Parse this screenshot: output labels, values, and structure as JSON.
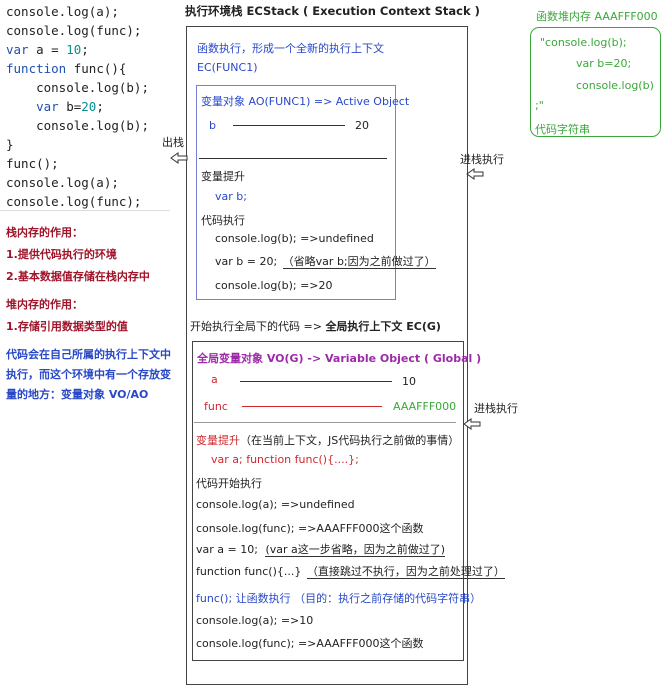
{
  "code": {
    "lines": [
      "console.log(a);",
      "console.log(func);",
      "var a = 10;",
      "function func(){",
      "    console.log(b);",
      "    var b=20;",
      "    console.log(b);",
      "}",
      "func();",
      "console.log(a);",
      "console.log(func);"
    ]
  },
  "notes": {
    "stack_title": "栈内存的作用：",
    "stack_1": "1.提供代码执行的环境",
    "stack_2": "2.基本数据值存储在栈内存中",
    "heap_title": "堆内存的作用：",
    "heap_1": "1.存储引用数据类型的值",
    "context_1": "代码会在自己所属的执行上下文中",
    "context_2": "执行，而这个环境中有一个存放变",
    "context_3": "量的地方：变量对象 VO/AO"
  },
  "ecstack": {
    "title": "执行环境栈  ECStack ( Execution Context Stack )",
    "exit_label": "出栈",
    "enter_label_1": "进栈执行",
    "enter_label_2": "进栈执行"
  },
  "func_ctx": {
    "line1": "函数执行，形成一个全新的执行上下文",
    "line2": "EC(FUNC1)",
    "ao_title": "变量对象 AO(FUNC1) => Active Object",
    "var_b": "b",
    "val_b": "20",
    "hoist_title": "变量提升",
    "hoist_code": "var b;",
    "exec_title": "代码执行",
    "exec_1": "console.log(b);  =>undefined",
    "exec_2a": "var b = 20;",
    "exec_2b": "（省略var b;因为之前做过了）",
    "exec_3": "console.log(b);  =>20"
  },
  "global_ctx": {
    "header_a": "开始执行全局下的代码  =>",
    "header_b": "全局执行上下文  EC(G)",
    "vo_title": "全局变量对象 VO(G)  -> Variable Object  ( Global )",
    "var_a": "a",
    "val_a": "10",
    "var_func": "func",
    "val_func": "AAAFFF000",
    "hoist_title": "变量提升",
    "hoist_desc": "（在当前上下文，JS代码执行之前做的事情）",
    "hoist_code": "var a;    function func(){....};",
    "exec_title": "代码开始执行",
    "exec_1": "console.log(a);  =>undefined",
    "exec_2": "console.log(func); =>AAAFFF000这个函数",
    "exec_3a": "var a = 10;",
    "exec_3b": "(var a这一步省略，因为之前做过了)",
    "exec_4a": "function func(){...}",
    "exec_4b": "（直接跳过不执行，因为之前处理过了）",
    "exec_5": "func();  让函数执行  （目的：执行之前存储的代码字符串）",
    "exec_6": "console.log(a);  =>10",
    "exec_7": "console.log(func); =>AAAFFF000这个函数"
  },
  "heap": {
    "title": "函数堆内存 AAAFFF000",
    "line1": "\"console.log(b);",
    "line2": "var b=20;",
    "line3": "console.log(b)",
    "line4": ";\"",
    "label": "代码字符串"
  },
  "colors": {
    "blue": "#2848c8",
    "dark_red": "#a0142a",
    "red": "#d0282e",
    "purple": "#9c2aa8",
    "green": "#3aa83a"
  }
}
